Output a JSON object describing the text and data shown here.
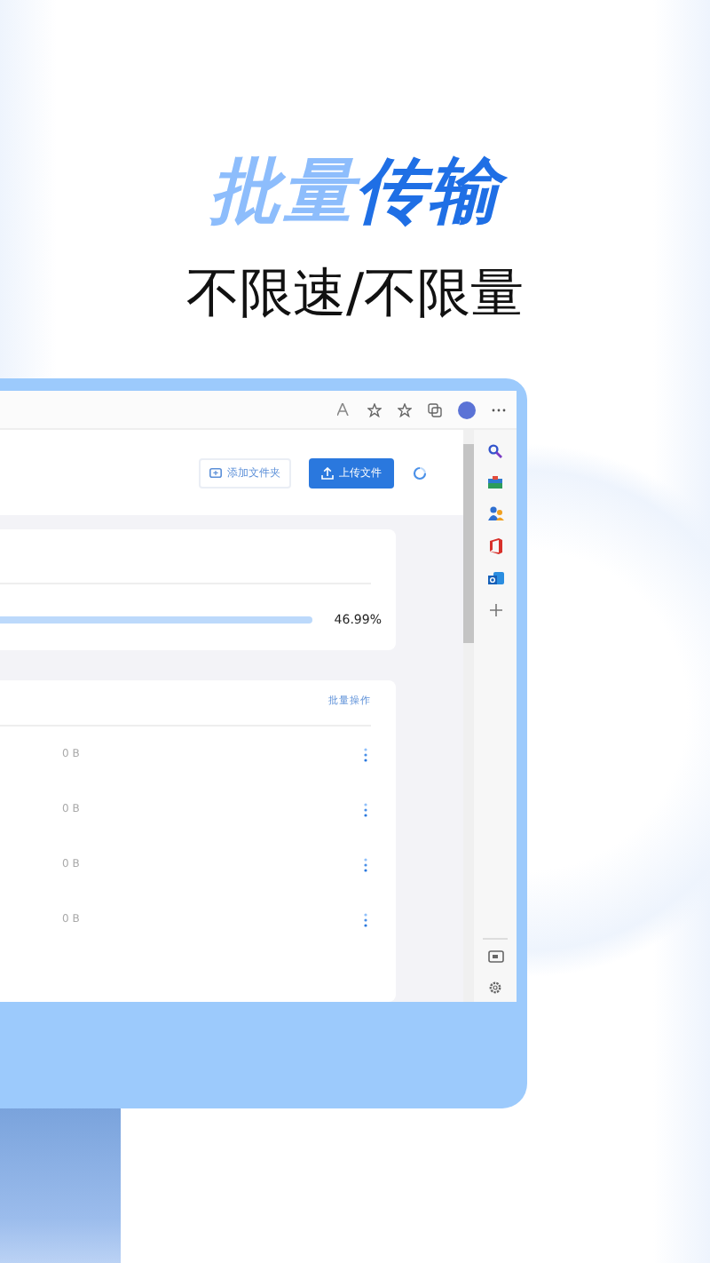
{
  "headline": [
    {
      "text": "批量",
      "color": "#8dbdfc"
    },
    {
      "text": "传输",
      "color": "#1f6fe5"
    }
  ],
  "subtitle": "不限速/不限量",
  "toolbar": {
    "buttons": [
      {
        "label": "添加文件夹",
        "kind": "outline"
      },
      {
        "label": "上传文件",
        "kind": "primary"
      }
    ]
  },
  "progress_card": {
    "percent": "46.99%"
  },
  "file_list": {
    "action": "批量操作",
    "rows": [
      {
        "size": "0 B"
      },
      {
        "size": "0 B"
      },
      {
        "size": "0 B"
      },
      {
        "size": "0 B"
      }
    ]
  }
}
